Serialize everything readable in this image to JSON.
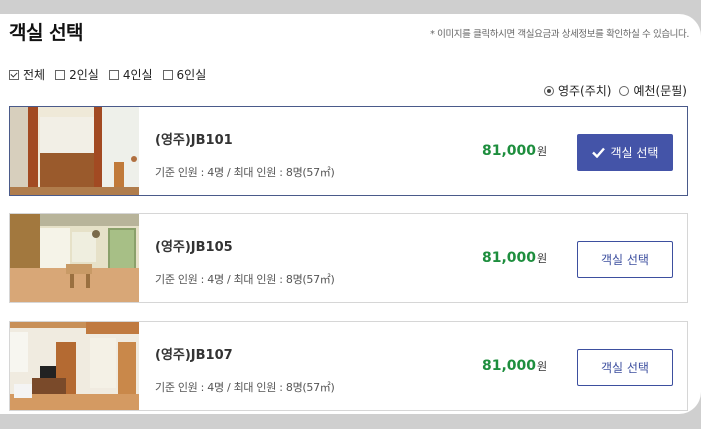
{
  "page": {
    "title": "객실 선택",
    "notice": "* 이미지를 클릭하시면 객실요금과 상세정보를 확인하실 수 있습니다."
  },
  "filters": [
    {
      "label": "전체",
      "checked": true
    },
    {
      "label": "2인실",
      "checked": false
    },
    {
      "label": "4인실",
      "checked": false
    },
    {
      "label": "6인실",
      "checked": false
    }
  ],
  "regions": [
    {
      "label": "영주(주치)",
      "checked": true
    },
    {
      "label": "예천(문필)",
      "checked": false
    }
  ],
  "rooms": [
    {
      "name": "(영주)JB101",
      "info": "기준 인원 : 4명 / 최대 인원 : 8명(57㎡)",
      "price": "81,000",
      "currency": "원",
      "button": "객실 선택",
      "selected": true
    },
    {
      "name": "(영주)JB105",
      "info": "기준 인원 : 4명 / 최대 인원 : 8명(57㎡)",
      "price": "81,000",
      "currency": "원",
      "button": "객실 선택",
      "selected": false
    },
    {
      "name": "(영주)JB107",
      "info": "기준 인원 : 4명 / 최대 인원 : 8명(57㎡)",
      "price": "81,000",
      "currency": "원",
      "button": "객실 선택",
      "selected": false
    }
  ],
  "colors": {
    "accent": "#4454a8",
    "price": "#1e8e3e"
  }
}
